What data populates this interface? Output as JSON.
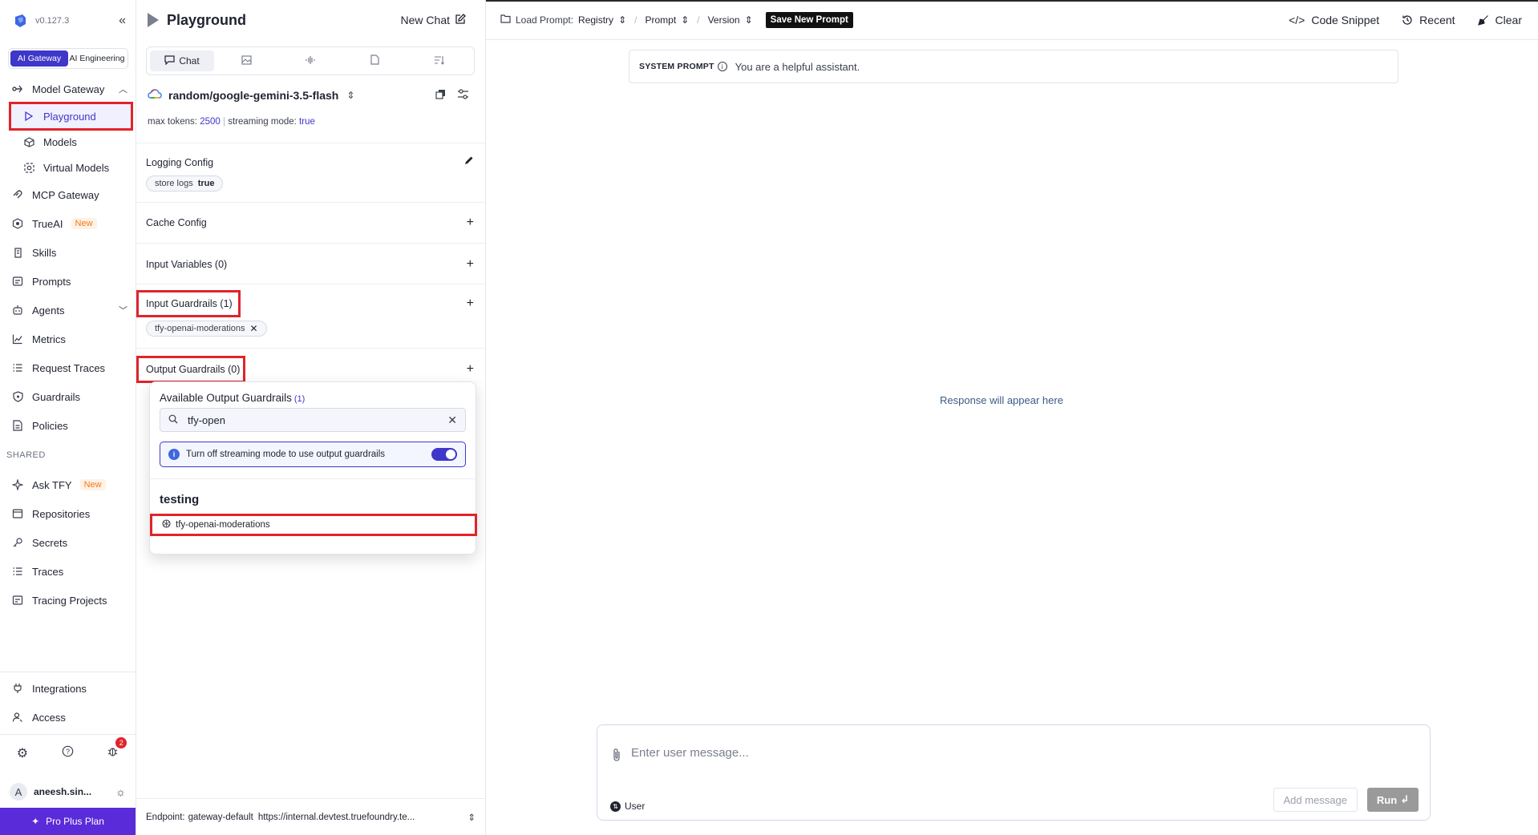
{
  "sidebar": {
    "version": "v0.127.3",
    "modes": [
      "AI Gateway",
      "AI Engineering"
    ],
    "items": [
      {
        "label": "Model Gateway",
        "icon": "gateway-icon"
      },
      {
        "label": "Playground",
        "icon": "play-icon"
      },
      {
        "label": "Models",
        "icon": "cube-icon"
      },
      {
        "label": "Virtual Models",
        "icon": "virtual-model-icon"
      },
      {
        "label": "MCP Gateway",
        "icon": "mcp-icon"
      },
      {
        "label": "TrueAI",
        "icon": "trueai-icon",
        "badge": "New"
      },
      {
        "label": "Skills",
        "icon": "skills-icon"
      },
      {
        "label": "Prompts",
        "icon": "prompts-icon"
      },
      {
        "label": "Agents",
        "icon": "agents-icon"
      },
      {
        "label": "Metrics",
        "icon": "metrics-icon"
      },
      {
        "label": "Request Traces",
        "icon": "traces-list-icon"
      },
      {
        "label": "Guardrails",
        "icon": "shield-icon"
      },
      {
        "label": "Policies",
        "icon": "policy-icon"
      }
    ],
    "shared_label": "SHARED",
    "shared_items": [
      {
        "label": "Ask TFY",
        "icon": "sparkle-icon",
        "badge": "New"
      },
      {
        "label": "Repositories",
        "icon": "repo-icon"
      },
      {
        "label": "Secrets",
        "icon": "key-icon"
      },
      {
        "label": "Traces",
        "icon": "traces-icon"
      },
      {
        "label": "Tracing Projects",
        "icon": "tracing-projects-icon"
      }
    ],
    "bottom_items": [
      {
        "label": "Integrations",
        "icon": "plug-icon"
      },
      {
        "label": "Access",
        "icon": "user-access-icon"
      }
    ],
    "notification_count": "2",
    "user": {
      "initial": "A",
      "name": "aneesh.sin..."
    },
    "plan": "Pro Plus Plan"
  },
  "config": {
    "title": "Playground",
    "new_chat": "New Chat",
    "tabs": [
      "Chat",
      "",
      "",
      "",
      ""
    ],
    "model": "random/google-gemini-3.5-flash",
    "max_tokens_label": "max tokens:",
    "max_tokens": "2500",
    "streaming_label": "streaming mode:",
    "streaming": "true",
    "logging_config": "Logging Config",
    "store_logs_label": "store logs",
    "store_logs_value": "true",
    "cache_config": "Cache Config",
    "input_variables": "Input Variables (0)",
    "input_guardrails": "Input Guardrails (1)",
    "input_guardrail_chip": "tfy-openai-moderations",
    "output_guardrails": "Output Guardrails (0)",
    "endpoint_label": "Endpoint:",
    "endpoint_name": "gateway-default",
    "endpoint_url": "https://internal.devtest.truefoundry.te..."
  },
  "dropdown": {
    "title": "Available Output Guardrails",
    "count": "(1)",
    "search_value": "tfy-open",
    "info": "Turn off streaming mode to use output guardrails",
    "group": "testing",
    "item": "tfy-openai-moderations"
  },
  "topbar": {
    "load_prompt": "Load Prompt:",
    "registry": "Registry",
    "prompt": "Prompt",
    "version": "Version",
    "save_new_prompt": "Save New Prompt",
    "code_snippet": "Code Snippet",
    "recent": "Recent",
    "clear": "Clear"
  },
  "main": {
    "system_prompt_label": "SYSTEM PROMPT",
    "system_prompt_text": "You are a helpful assistant.",
    "response_placeholder": "Response will appear here",
    "message_placeholder": "Enter user message...",
    "role": "User",
    "add_message": "Add message",
    "run": "Run"
  },
  "colors": {
    "accent": "#3f37c9",
    "highlight": "#e0242b",
    "plan_bg": "#5a2bd8"
  }
}
